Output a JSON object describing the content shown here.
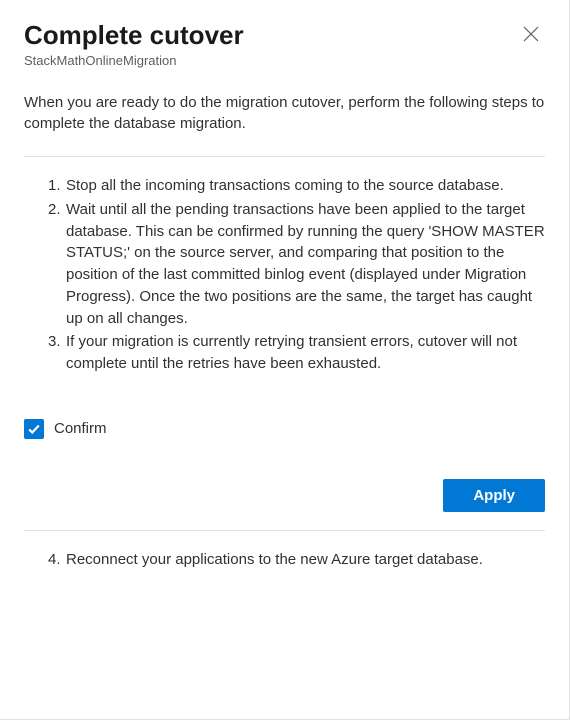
{
  "header": {
    "title": "Complete cutover",
    "subtitle": "StackMathOnlineMigration"
  },
  "intro": "When you are ready to do the migration cutover, perform the following steps to complete the database migration.",
  "steps": {
    "s1": "Stop all the incoming transactions coming to the source database.",
    "s2": "Wait until all the pending transactions have been applied to the target database. This can be confirmed by running the query 'SHOW MASTER STATUS;' on the source server, and comparing that position to the position of the last committed binlog event (displayed under Migration Progress). Once the two positions are the same, the target has caught up on all changes.",
    "s3": "If your migration is currently retrying transient errors, cutover will not complete until the retries have been exhausted.",
    "s4_num": "4.",
    "s4": "Reconnect your applications to the new Azure target database."
  },
  "confirm": {
    "label": "Confirm",
    "checked": true
  },
  "buttons": {
    "apply": "Apply"
  }
}
